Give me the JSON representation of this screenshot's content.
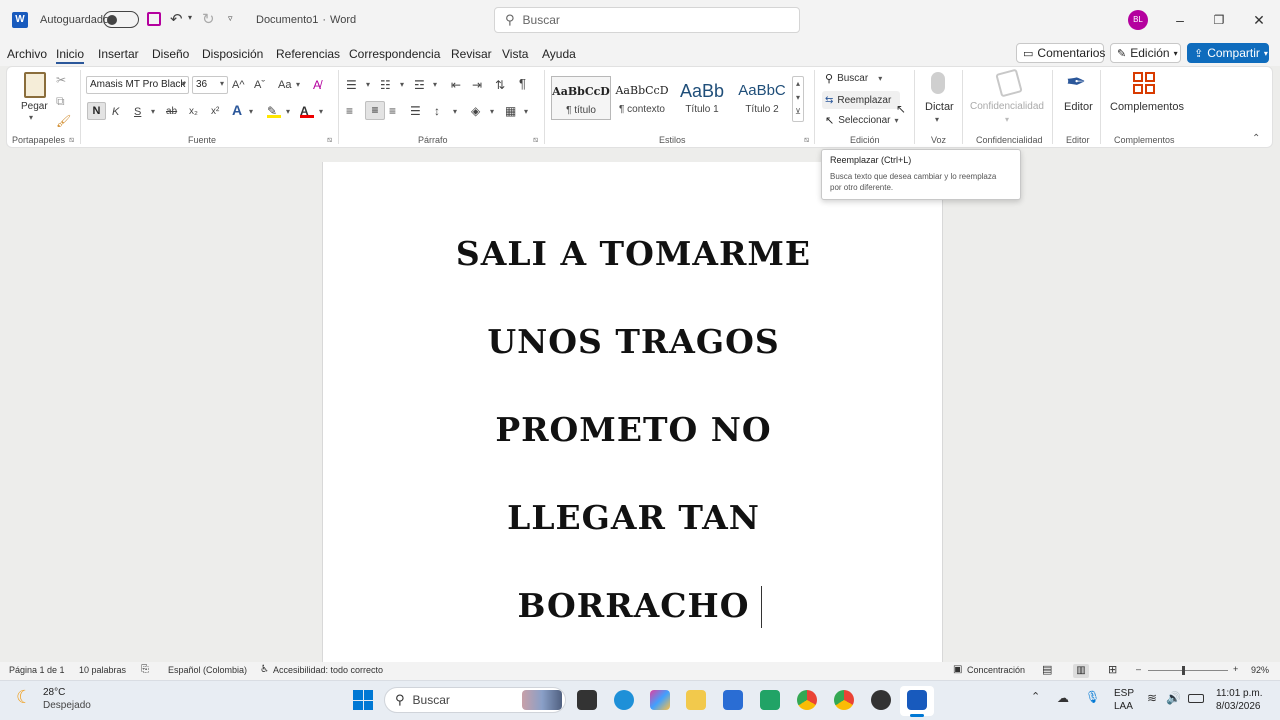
{
  "titlebar": {
    "autosave_label": "Autoguardado",
    "doc_name": "Documento1",
    "separator": "·",
    "app_name": "Word",
    "search_placeholder": "Buscar",
    "avatar_initials": "BL"
  },
  "menu": {
    "items": [
      "Archivo",
      "Inicio",
      "Insertar",
      "Diseño",
      "Disposición",
      "Referencias",
      "Correspondencia",
      "Revisar",
      "Vista",
      "Ayuda"
    ],
    "active": "Inicio",
    "comments_label": "Comentarios",
    "editing_label": "Edición",
    "share_label": "Compartir"
  },
  "ribbon": {
    "clipboard": {
      "paste_label": "Pegar",
      "group_label": "Portapapeles"
    },
    "font": {
      "font_name": "Amasis MT Pro Black",
      "font_size": "36",
      "bold": "N",
      "italic": "K",
      "underline": "S",
      "strike": "ab",
      "subscript": "x₂",
      "superscript": "x²",
      "grow": "A^",
      "shrink": "Aˇ",
      "case": "Aa",
      "group_label": "Fuente"
    },
    "paragraph": {
      "group_label": "Párrafo",
      "pilcrow": "¶"
    },
    "styles": {
      "items": [
        {
          "preview": "AaBbCcD",
          "name": "¶ título"
        },
        {
          "preview": "AaBbCcD",
          "name": "¶ contexto"
        },
        {
          "preview": "AaBb",
          "name": "Título 1"
        },
        {
          "preview": "AaBbC",
          "name": "Título 2"
        }
      ],
      "group_label": "Estilos"
    },
    "editing": {
      "find": "Buscar",
      "replace": "Reemplazar",
      "select": "Seleccionar",
      "group_label": "Edición"
    },
    "voice": {
      "dictate": "Dictar",
      "group_label": "Voz"
    },
    "sensitivity": {
      "label": "Confidencialidad",
      "group_label": "Confidencialidad"
    },
    "editor": {
      "label": "Editor",
      "group_label": "Editor"
    },
    "addins": {
      "label": "Complementos",
      "group_label": "Complementos"
    }
  },
  "tooltip": {
    "title": "Reemplazar (Ctrl+L)",
    "body_line1": "Busca texto que desea cambiar y lo reemplaza",
    "body_line2": "por otro diferente."
  },
  "document": {
    "lines": [
      "SALI A TOMARME",
      "UNOS TRAGOS",
      "PROMETO NO",
      "LLEGAR TAN",
      "BORRACHO"
    ]
  },
  "status": {
    "page": "Página 1 de 1",
    "words": "10 palabras",
    "language": "Español (Colombia)",
    "accessibility": "Accesibilidad: todo correcto",
    "focus": "Concentración",
    "zoom": "92%",
    "zoom_value": 0.92
  },
  "taskbar": {
    "temperature": "28°C",
    "weather": "Despejado",
    "search_placeholder": "Buscar",
    "lang_line1": "ESP",
    "lang_line2": "LAA",
    "time": "11:01 p.m.",
    "date": "8/03/2026"
  },
  "colors": {
    "accent": "#2b579a",
    "share_button": "#0f6cbd",
    "avatar": "#b4009e"
  }
}
